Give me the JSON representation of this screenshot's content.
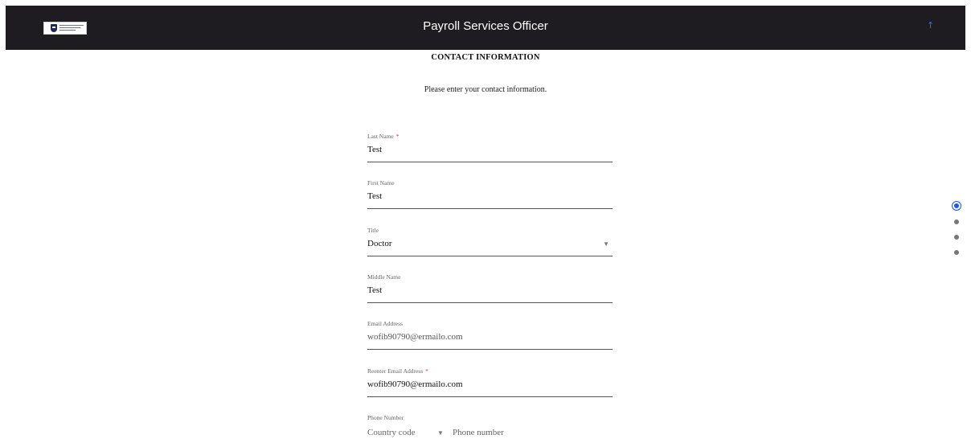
{
  "header": {
    "title": "Payroll Services Officer",
    "logo_icon": "university-logo-icon",
    "scroll_top_icon": "arrow-up-icon",
    "scroll_top_glyph": "↑"
  },
  "section": {
    "title": "CONTACT INFORMATION",
    "description": "Please enter your contact information."
  },
  "fields": {
    "last_name": {
      "label": "Last Name",
      "required_mark": "*",
      "value": "Test"
    },
    "first_name": {
      "label": "First Name",
      "value": "Test"
    },
    "title": {
      "label": "Title",
      "value": "Doctor",
      "caret": "▼"
    },
    "middle_name": {
      "label": "Middle Name",
      "value": "Test"
    },
    "email": {
      "label": "Email Address",
      "value": "wofib90790@ermailo.com"
    },
    "email_confirm": {
      "label": "Reenter Email Address",
      "required_mark": "*",
      "value": "wofib90790@ermailo.com"
    },
    "phone": {
      "label": "Phone Number",
      "country_code_placeholder": "Country code",
      "caret": "▼",
      "number_placeholder": "Phone number"
    }
  },
  "pager": {
    "pages": 4,
    "active_index": 0
  },
  "colors": {
    "header_bg": "#1f1c21",
    "accent": "#1a56ff",
    "required": "#dd3333"
  }
}
